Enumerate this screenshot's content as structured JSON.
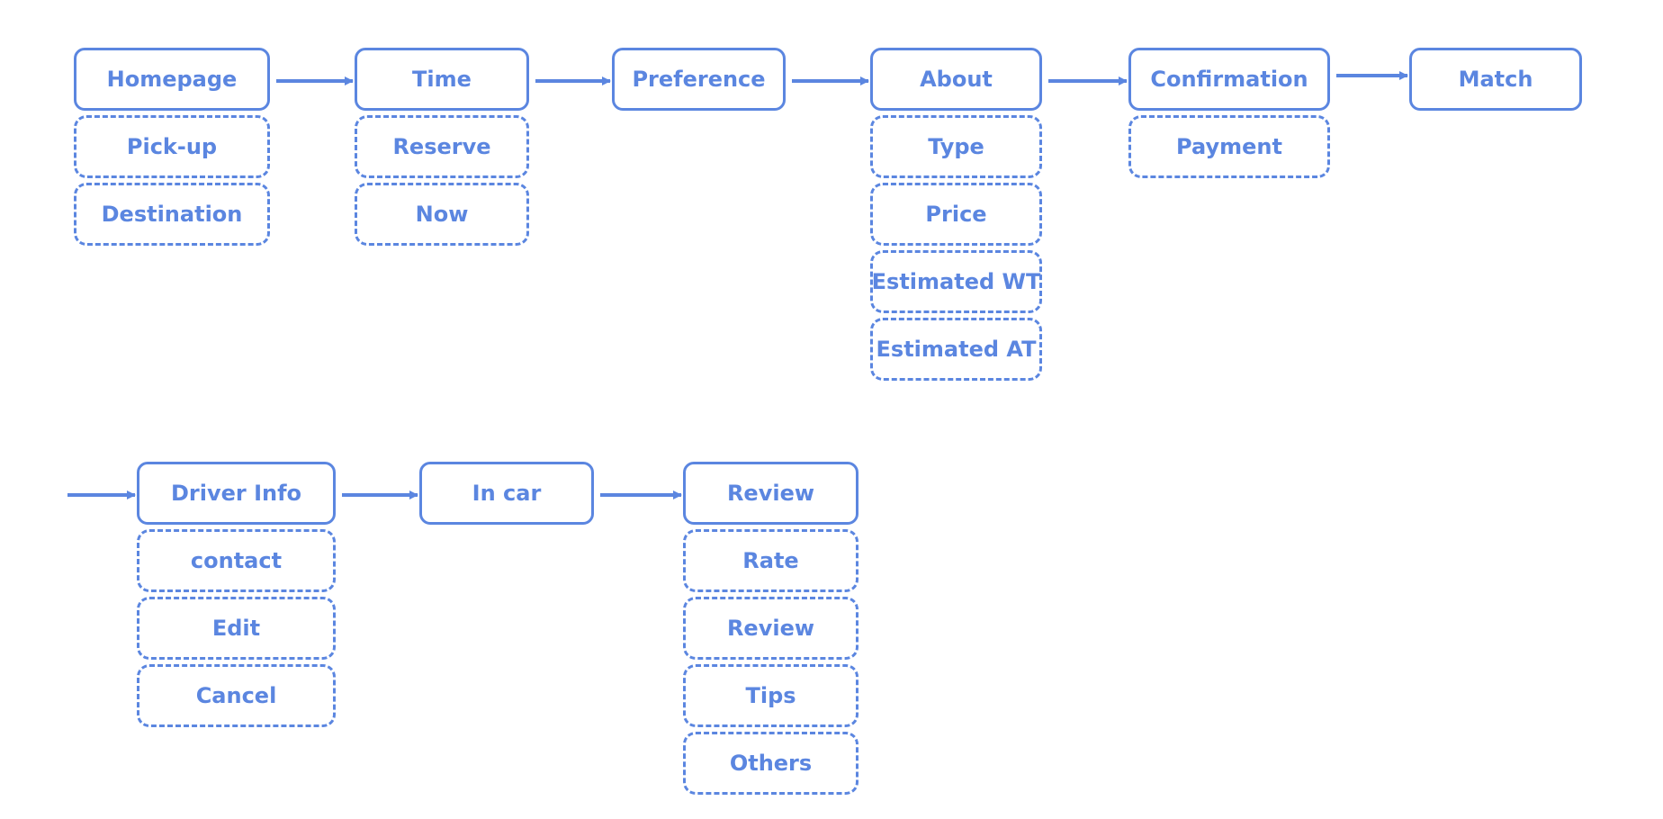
{
  "accent_color": "#5b86e0",
  "row1": [
    {
      "id": "homepage",
      "label": "Homepage",
      "children": [
        "Pick-up",
        "Destination"
      ]
    },
    {
      "id": "time",
      "label": "Time",
      "children": [
        "Reserve",
        "Now"
      ]
    },
    {
      "id": "preference",
      "label": "Preference",
      "children": []
    },
    {
      "id": "about",
      "label": "About",
      "children": [
        "Type",
        "Price",
        "Estimated WT",
        "Estimated AT"
      ]
    },
    {
      "id": "confirmation",
      "label": "Confirmation",
      "children": [
        "Payment"
      ]
    },
    {
      "id": "match",
      "label": "Match",
      "children": []
    }
  ],
  "row2": [
    {
      "id": "driver-info",
      "label": "Driver Info",
      "children": [
        "contact",
        "Edit",
        "Cancel"
      ]
    },
    {
      "id": "in-car",
      "label": "In car",
      "children": []
    },
    {
      "id": "review",
      "label": "Review",
      "children": [
        "Rate",
        "Review",
        "Tips",
        "Others"
      ]
    }
  ],
  "edges": [
    [
      "homepage",
      "time"
    ],
    [
      "time",
      "preference"
    ],
    [
      "preference",
      "about"
    ],
    [
      "about",
      "confirmation"
    ],
    [
      "confirmation",
      "match"
    ],
    [
      "start",
      "driver-info"
    ],
    [
      "driver-info",
      "in-car"
    ],
    [
      "in-car",
      "review"
    ]
  ]
}
